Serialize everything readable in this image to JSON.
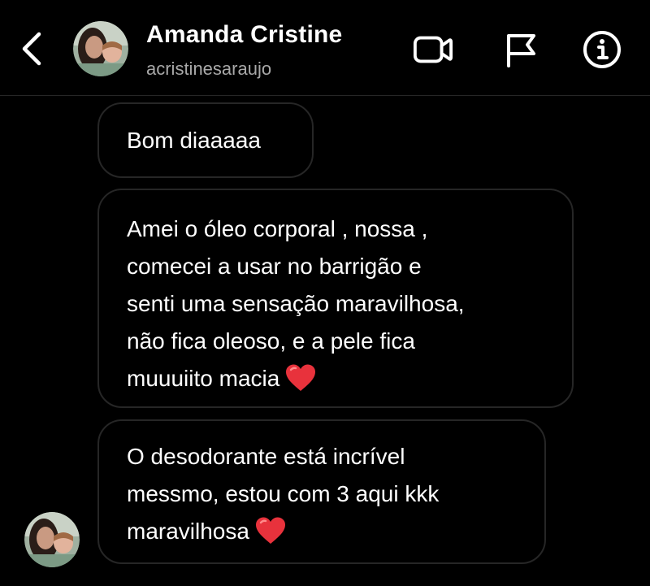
{
  "header": {
    "back_icon": "chevron-left-icon",
    "contact_name": "Amanda Cristine",
    "contact_username": "acristinesaraujo",
    "video_icon": "video-camera-icon",
    "flag_icon": "flag-icon",
    "info_icon": "info-icon"
  },
  "messages": [
    {
      "lines": [
        "Bom diaaaaa"
      ]
    },
    {
      "lines": [
        "Amei o óleo corporal , nossa ,",
        "comecei a usar no barrigão e",
        "senti uma sensação maravilhosa,",
        "não fica oleoso, e a pele fica",
        "muuuiito macia"
      ],
      "emoji": "heart-emoji"
    },
    {
      "lines": [
        "O desodorante está incrível",
        "messmo, estou com 3 aqui kkk",
        "maravilhosa"
      ],
      "emoji": "heart-emoji"
    }
  ],
  "colors": {
    "background": "#000000",
    "text": "#ffffff",
    "secondary_text": "#a8a8a8",
    "bubble_border": "#262626",
    "heart": "#e8323c"
  }
}
